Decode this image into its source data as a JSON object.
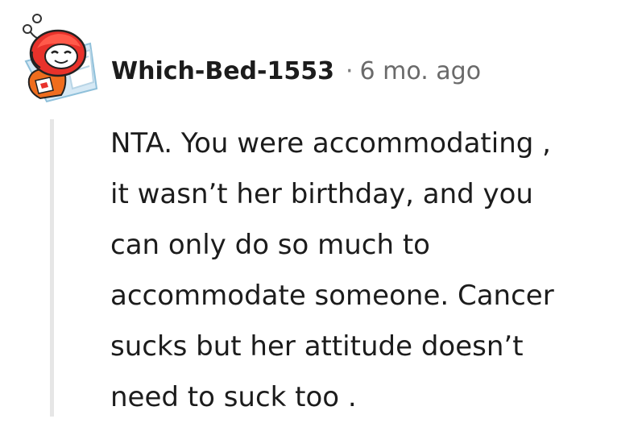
{
  "comment": {
    "author": "Which-Bed-1553",
    "separator": "·",
    "timestamp": "6 mo. ago",
    "body_lines": [
      "NTA. You were accommodating ,",
      "it wasn’t her birthday, and you",
      "can only do so much to",
      "accommodate someone. Cancer",
      "sucks but her attitude doesn’t",
      "need to suck too ."
    ]
  },
  "avatar": {
    "icon": "reddit-snoo-avatar-icon",
    "head_color": "#e8322b",
    "body_color": "#ef6d1e",
    "frame_color": "#a9cfe3"
  },
  "colors": {
    "text": "#1c1c1c",
    "meta": "#6a6a6a",
    "thread_line": "#e6e6e6"
  }
}
